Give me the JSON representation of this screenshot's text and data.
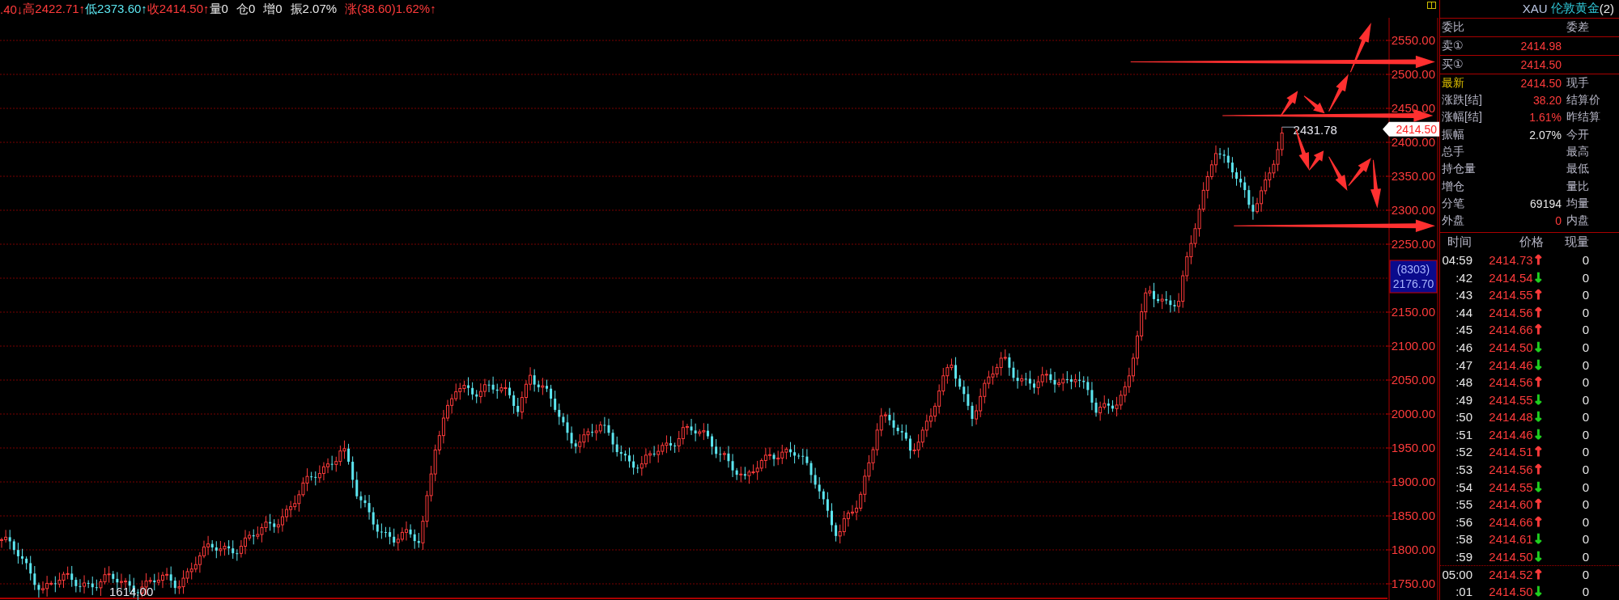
{
  "quote_bar": [
    {
      "text": ".40↓",
      "color": "#ff3b3b"
    },
    {
      "text": "高2422.71↑",
      "color": "#ff3b3b"
    },
    {
      "text": "低2373.60↑",
      "color": "#5ce6f0"
    },
    {
      "text": "收2414.50↑",
      "color": "#ff3b3b"
    },
    {
      "text": "量0",
      "color": "#e8e8e8"
    },
    {
      "text": "仓0",
      "color": "#e8e8e8"
    },
    {
      "text": "增0",
      "color": "#e8e8e8"
    },
    {
      "text": "振2.07%",
      "color": "#e8e8e8"
    },
    {
      "text": "涨(38.60)1.62%↑",
      "color": "#ff3b3b"
    }
  ],
  "chart": {
    "high_label": "2431.78",
    "low_label": "1614.00",
    "axis_labels": [
      "2550.00",
      "2500.00",
      "2450.00",
      "2400.00",
      "2350.00",
      "2300.00",
      "2250.00",
      "2150.00",
      "2100.00",
      "2050.00",
      "2000.00",
      "1950.00",
      "1900.00",
      "1850.00",
      "1800.00",
      "1750.00"
    ],
    "last_price": "2414.50",
    "cursor": {
      "count": "(8303)",
      "price": "2176.70"
    }
  },
  "panel": {
    "title": {
      "code": "XAU",
      "name": "伦敦黄金",
      "suffix": "(2)"
    },
    "order_rows": [
      {
        "label": "委比",
        "label2": "委差"
      },
      {
        "label": "卖①",
        "value": "2414.98",
        "color": "#ff3b3b"
      },
      {
        "label": "买①",
        "value": "2414.50",
        "color": "#ff3b3b"
      }
    ],
    "stats": [
      {
        "label": "最新",
        "value": "2414.50",
        "label2": "现手",
        "color": "#ff3b3b",
        "highlight": true
      },
      {
        "label": "涨跌[结]",
        "value": "38.20",
        "label2": "结算价",
        "color": "#ff3b3b",
        "highlight": false
      },
      {
        "label": "涨幅[结]",
        "value": "1.61%",
        "label2": "昨结算",
        "color": "#ff3b3b",
        "highlight": false
      },
      {
        "label": "振幅",
        "value": "2.07%",
        "label2": "今开",
        "color": "#e8e8e8",
        "highlight": false
      },
      {
        "label": "总手",
        "label2": "最高",
        "highlight": false
      },
      {
        "label": "持仓量",
        "label2": "最低",
        "highlight": false
      },
      {
        "label": "增仓",
        "label2": "量比",
        "highlight": false
      },
      {
        "label": "分笔",
        "value": "69194",
        "label2": "均量",
        "color": "#e8e8e8",
        "highlight": false
      },
      {
        "label": "外盘",
        "value": "0",
        "label2": "内盘",
        "color": "#ff3b3b",
        "highlight": false
      }
    ],
    "trades": {
      "columns": [
        "时间",
        "价格",
        "现量"
      ],
      "rows": [
        {
          "time": "04:59",
          "price": "2414.73",
          "arrow": "↑",
          "color": "#ff3b3b",
          "volume": "0",
          "break_before": false
        },
        {
          "time": ":42",
          "price": "2414.54",
          "arrow": "↓",
          "color": "#20d020",
          "volume": "0",
          "break_before": false
        },
        {
          "time": ":43",
          "price": "2414.55",
          "arrow": "↑",
          "color": "#ff3b3b",
          "volume": "0",
          "break_before": false
        },
        {
          "time": ":44",
          "price": "2414.56",
          "arrow": "↑",
          "color": "#ff3b3b",
          "volume": "0",
          "break_before": false
        },
        {
          "time": ":45",
          "price": "2414.66",
          "arrow": "↑",
          "color": "#ff3b3b",
          "volume": "0",
          "break_before": false
        },
        {
          "time": ":46",
          "price": "2414.50",
          "arrow": "↓",
          "color": "#20d020",
          "volume": "0",
          "break_before": false
        },
        {
          "time": ":47",
          "price": "2414.46",
          "arrow": "↓",
          "color": "#20d020",
          "volume": "0",
          "break_before": false
        },
        {
          "time": ":48",
          "price": "2414.56",
          "arrow": "↑",
          "color": "#ff3b3b",
          "volume": "0",
          "break_before": false
        },
        {
          "time": ":49",
          "price": "2414.55",
          "arrow": "↓",
          "color": "#20d020",
          "volume": "0",
          "break_before": false
        },
        {
          "time": ":50",
          "price": "2414.48",
          "arrow": "↓",
          "color": "#20d020",
          "volume": "0",
          "break_before": false
        },
        {
          "time": ":51",
          "price": "2414.46",
          "arrow": "↓",
          "color": "#20d020",
          "volume": "0",
          "break_before": false
        },
        {
          "time": ":52",
          "price": "2414.51",
          "arrow": "↑",
          "color": "#ff3b3b",
          "volume": "0",
          "break_before": false
        },
        {
          "time": ":53",
          "price": "2414.56",
          "arrow": "↑",
          "color": "#ff3b3b",
          "volume": "0",
          "break_before": false
        },
        {
          "time": ":54",
          "price": "2414.55",
          "arrow": "↓",
          "color": "#20d020",
          "volume": "0",
          "break_before": false
        },
        {
          "time": ":55",
          "price": "2414.60",
          "arrow": "↑",
          "color": "#ff3b3b",
          "volume": "0",
          "break_before": false
        },
        {
          "time": ":56",
          "price": "2414.66",
          "arrow": "↑",
          "color": "#ff3b3b",
          "volume": "0",
          "break_before": false
        },
        {
          "time": ":58",
          "price": "2414.61",
          "arrow": "↓",
          "color": "#20d020",
          "volume": "0",
          "break_before": false
        },
        {
          "time": ":59",
          "price": "2414.50",
          "arrow": "↓",
          "color": "#20d020",
          "volume": "0",
          "break_before": false
        },
        {
          "time": "05:00",
          "price": "2414.52",
          "arrow": "↑",
          "color": "#ff3b3b",
          "volume": "0",
          "break_before": true
        },
        {
          "time": ":01",
          "price": "2414.50",
          "arrow": "↓",
          "color": "#20d020",
          "volume": "0",
          "break_before": false
        }
      ]
    }
  }
}
